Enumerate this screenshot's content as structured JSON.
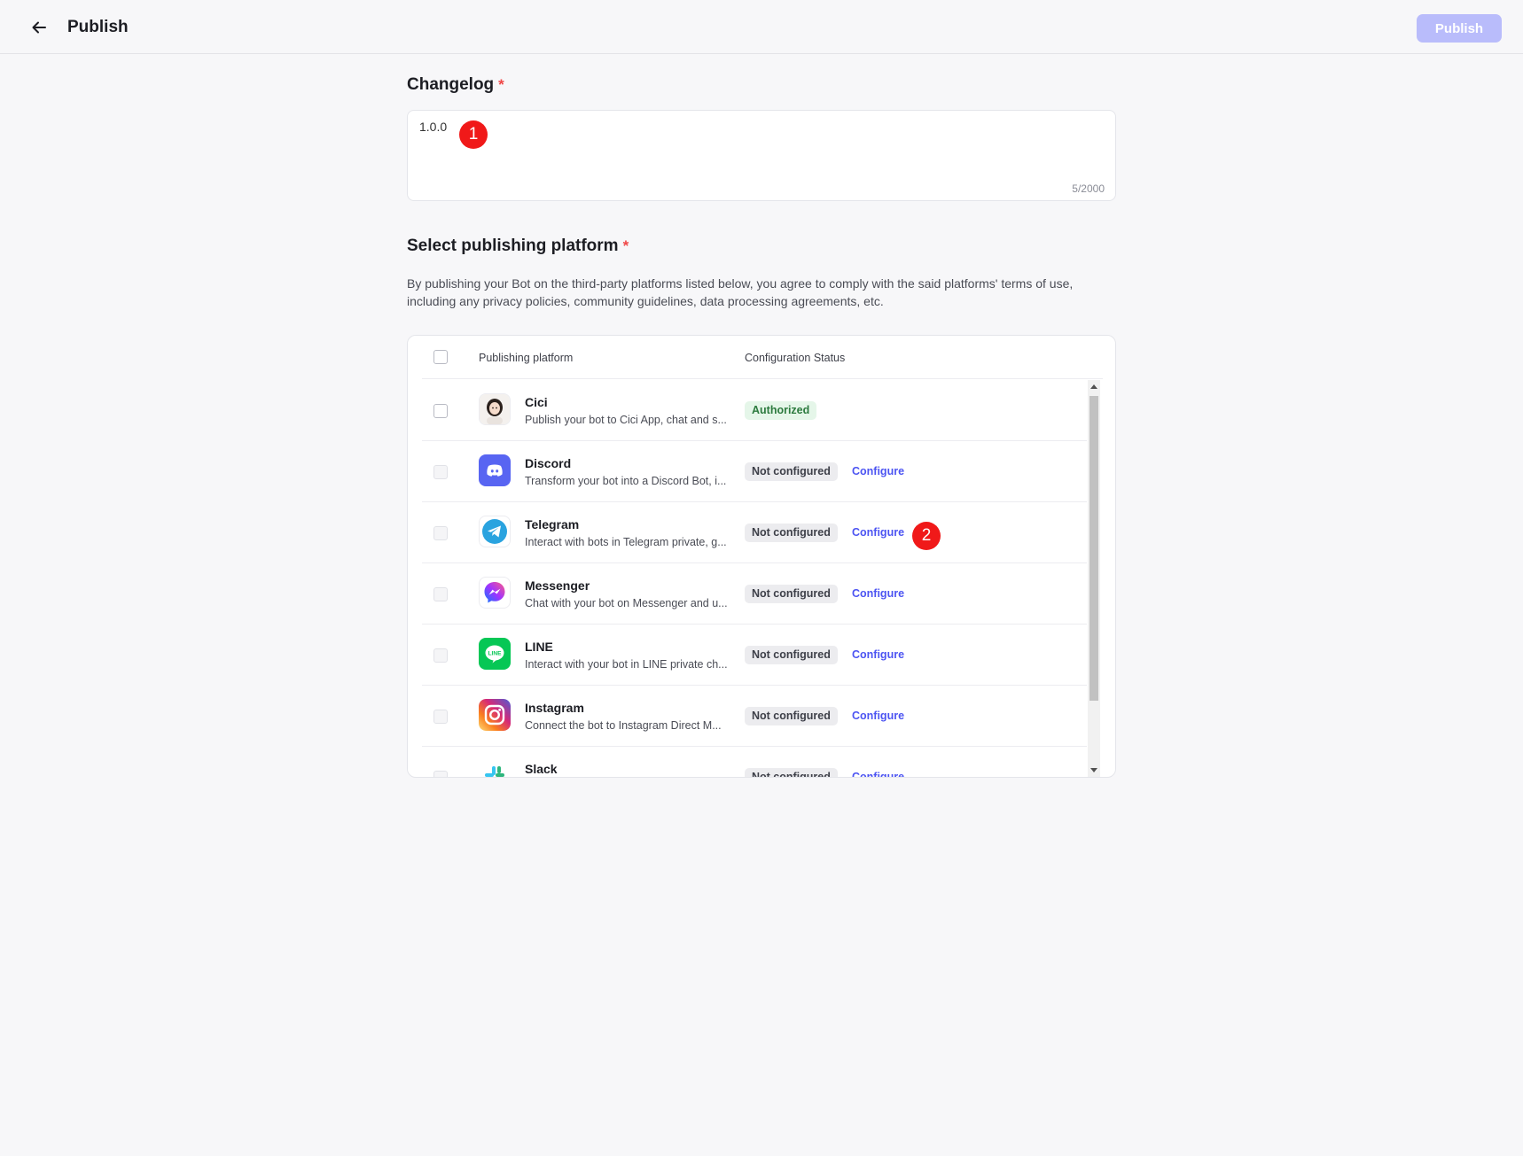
{
  "header": {
    "title": "Publish",
    "publish_label": "Publish",
    "back_icon": "arrow-left-icon"
  },
  "changelog": {
    "title": "Changelog",
    "required_mark": "*",
    "value": "1.0.0",
    "char_count": "5/2000"
  },
  "platform_section": {
    "title": "Select publishing platform",
    "required_mark": "*",
    "disclaimer": "By publishing your Bot on the third-party platforms listed below, you agree to comply with the said platforms' terms of use, including any privacy policies, community guidelines, data processing agreements, etc.",
    "columns": [
      "Publishing platform",
      "Configuration Status"
    ],
    "rows": [
      {
        "name": "Cici",
        "desc": "Publish your bot to Cici App, chat and s...",
        "status": "Authorized",
        "configure": "",
        "icon": "cici-avatar-icon"
      },
      {
        "name": "Discord",
        "desc": "Transform your bot into a Discord Bot, i...",
        "status": "Not configured",
        "configure": "Configure",
        "icon": "discord-icon"
      },
      {
        "name": "Telegram",
        "desc": "Interact with bots in Telegram private, g...",
        "status": "Not configured",
        "configure": "Configure",
        "icon": "telegram-icon"
      },
      {
        "name": "Messenger",
        "desc": "Chat with your bot on Messenger and u...",
        "status": "Not configured",
        "configure": "Configure",
        "icon": "messenger-icon"
      },
      {
        "name": "LINE",
        "desc": "Interact with your bot in LINE private ch...",
        "status": "Not configured",
        "configure": "Configure",
        "icon": "line-icon"
      },
      {
        "name": "Instagram",
        "desc": "Connect the bot to Instagram Direct M...",
        "status": "Not configured",
        "configure": "Configure",
        "icon": "instagram-icon"
      },
      {
        "name": "Slack",
        "desc": "",
        "status": "Not configured",
        "configure": "Configure",
        "icon": "slack-icon"
      }
    ]
  },
  "markers": [
    "1",
    "2"
  ],
  "colors": {
    "accent": "#4c54f2",
    "publish_disabled": "#b9bcfb",
    "marker": "#f01919",
    "authorized_bg": "#e5f6e9",
    "authorized_text": "#2c7a3e"
  }
}
